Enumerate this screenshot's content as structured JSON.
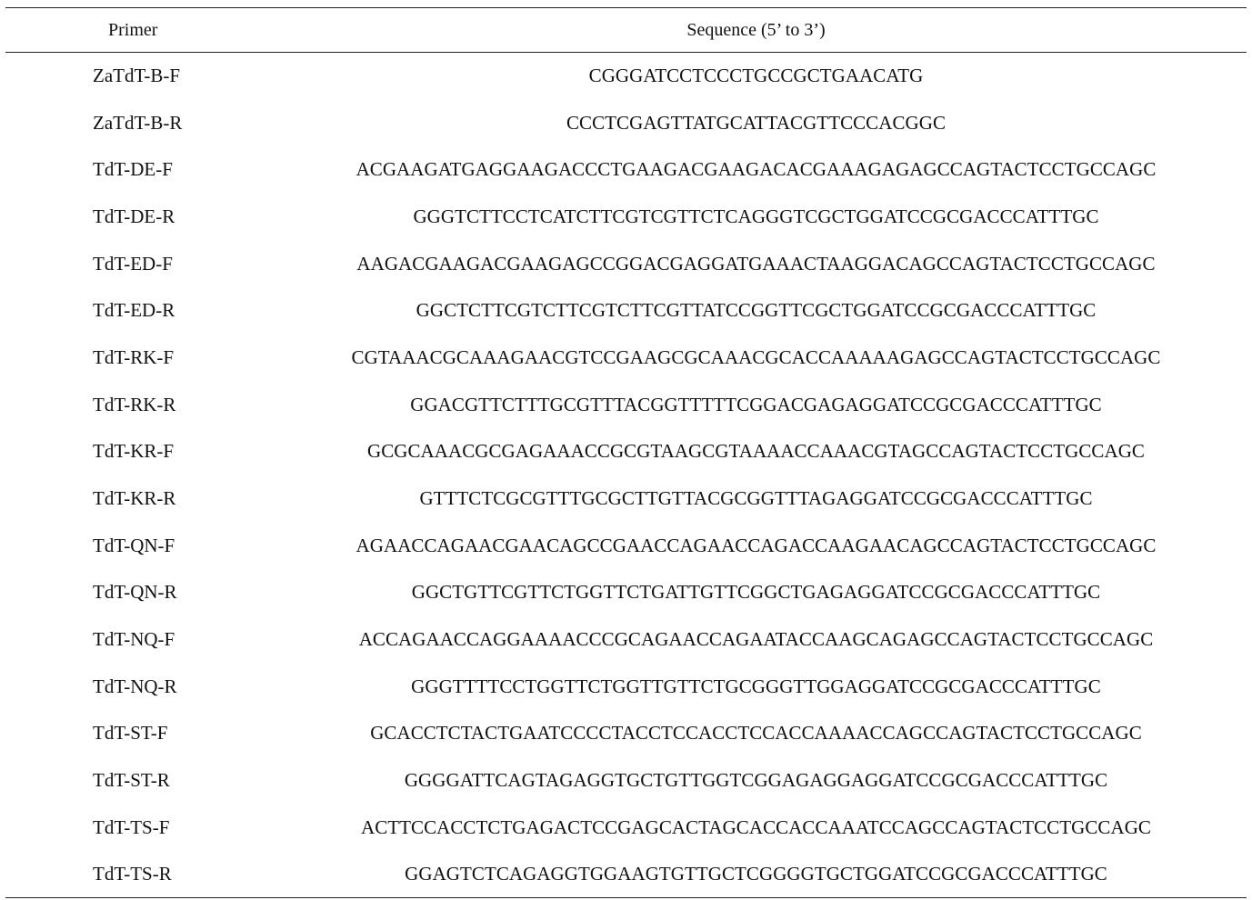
{
  "table": {
    "headers": {
      "primer": "Primer",
      "sequence": "Sequence (5’ to 3’)"
    },
    "rows": [
      {
        "primer": "ZaTdT-B-F",
        "sequence": "CGGGATCCTCCCTGCCGCTGAACATG"
      },
      {
        "primer": "ZaTdT-B-R",
        "sequence": "CCCTCGAGTTATGCATTACGTTCCCACGGC"
      },
      {
        "primer": "TdT-DE-F",
        "sequence": "ACGAAGATGAGGAAGACCCTGAAGACGAAGACACGAAAGAGAGCCAGTACTCCTGCCAGC"
      },
      {
        "primer": "TdT-DE-R",
        "sequence": "GGGTCTTCCTCATCTTCGTCGTTCTCAGGGTCGCTGGATCCGCGACCCATTTGC"
      },
      {
        "primer": "TdT-ED-F",
        "sequence": "AAGACGAAGACGAAGAGCCGGACGAGGATGAAACTAAGGACAGCCAGTACTCCTGCCAGC"
      },
      {
        "primer": "TdT-ED-R",
        "sequence": "GGCTCTTCGTCTTCGTCTTCGTTATCCGGTTCGCTGGATCCGCGACCCATTTGC"
      },
      {
        "primer": "TdT-RK-F",
        "sequence": "CGTAAACGCAAAGAACGTCCGAAGCGCAAACGCACCAAAAAGAGCCAGTACTCCTGCCAGC"
      },
      {
        "primer": "TdT-RK-R",
        "sequence": "GGACGTTCTTTGCGTTTACGGTTTTTCGGACGAGAGGATCCGCGACCCATTTGC"
      },
      {
        "primer": "TdT-KR-F",
        "sequence": "GCGCAAACGCGAGAAACCGCGTAAGCGTAAAACCAAACGTAGCCAGTACTCCTGCCAGC"
      },
      {
        "primer": "TdT-KR-R",
        "sequence": "GTTTCTCGCGTTTGCGCTTGTTACGCGGTTTAGAGGATCCGCGACCCATTTGC"
      },
      {
        "primer": "TdT-QN-F",
        "sequence": "AGAACCAGAACGAACAGCCGAACCAGAACCAGACCAAGAACAGCCAGTACTCCTGCCAGC"
      },
      {
        "primer": "TdT-QN-R",
        "sequence": "GGCTGTTCGTTCTGGTTCTGATTGTTCGGCTGAGAGGATCCGCGACCCATTTGC"
      },
      {
        "primer": "TdT-NQ-F",
        "sequence": "ACCAGAACCAGGAAAACCCGCAGAACCAGAATACCAAGCAGAGCCAGTACTCCTGCCAGC"
      },
      {
        "primer": "TdT-NQ-R",
        "sequence": "GGGTTTTCCTGGTTCTGGTTGTTCTGCGGGTTGGAGGATCCGCGACCCATTTGC"
      },
      {
        "primer": "TdT-ST-F",
        "sequence": "GCACCTCTACTGAATCCCCTACCTCCACCTCCACCAAAACCAGCCAGTACTCCTGCCAGC"
      },
      {
        "primer": "TdT-ST-R",
        "sequence": "GGGGATTCAGTAGAGGTGCTGTTGGTCGGAGAGGAGGATCCGCGACCCATTTGC"
      },
      {
        "primer": "TdT-TS-F",
        "sequence": "ACTTCCACCTCTGAGACTCCGAGCACTAGCACCACCAAATCCAGCCAGTACTCCTGCCAGC"
      },
      {
        "primer": "TdT-TS-R",
        "sequence": "GGAGTCTCAGAGGTGGAAGTGTTGCTCGGGGTGCTGGATCCGCGACCCATTTGC"
      }
    ]
  }
}
